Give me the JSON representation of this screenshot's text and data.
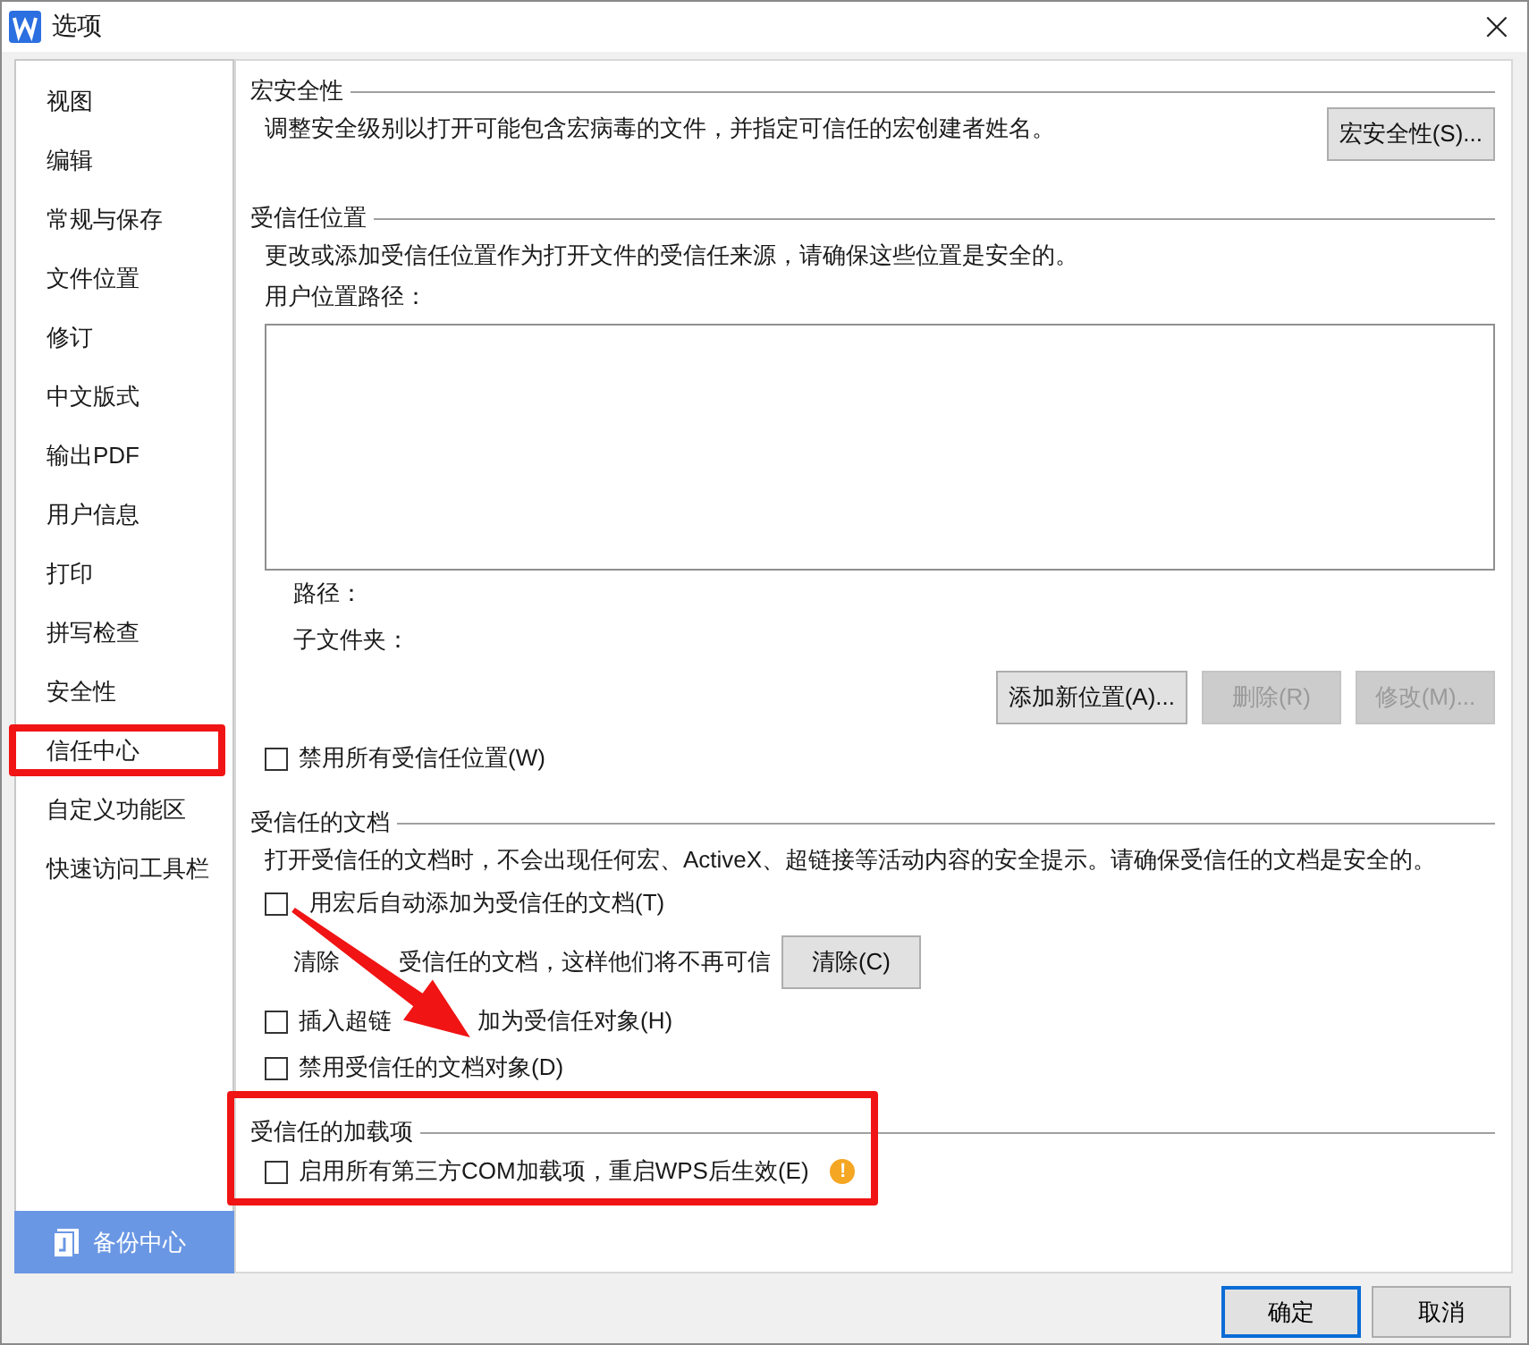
{
  "window": {
    "title": "选项",
    "close": "×"
  },
  "sidebar": {
    "items": [
      {
        "label": "视图",
        "highlighted": false
      },
      {
        "label": "编辑",
        "highlighted": false
      },
      {
        "label": "常规与保存",
        "highlighted": false
      },
      {
        "label": "文件位置",
        "highlighted": false
      },
      {
        "label": "修订",
        "highlighted": false
      },
      {
        "label": "中文版式",
        "highlighted": false
      },
      {
        "label": "输出PDF",
        "highlighted": false
      },
      {
        "label": "用户信息",
        "highlighted": false
      },
      {
        "label": "打印",
        "highlighted": false
      },
      {
        "label": "拼写检查",
        "highlighted": false
      },
      {
        "label": "安全性",
        "highlighted": false
      },
      {
        "label": "信任中心",
        "highlighted": true
      },
      {
        "label": "自定义功能区",
        "highlighted": false
      },
      {
        "label": "快速访问工具栏",
        "highlighted": false
      }
    ],
    "backup_button": "备份中心"
  },
  "sections": [
    {
      "heading": "宏安全性",
      "rows": [
        {
          "kind": "text_button",
          "text": "调整安全级别以打开可能包含宏病毒的文件，并指定可信任的宏创建者姓名。",
          "button": {
            "label": "宏安全性(S)...",
            "disabled": false
          }
        }
      ]
    },
    {
      "heading": "受信任位置",
      "rows": [
        {
          "kind": "text",
          "text": "更改或添加受信任位置作为打开文件的受信任来源，请确保这些位置是安全的。"
        },
        {
          "kind": "text",
          "text": "用户位置路径："
        },
        {
          "kind": "listbox"
        },
        {
          "kind": "info",
          "text": "路径："
        },
        {
          "kind": "info",
          "text": "子文件夹："
        },
        {
          "kind": "buttons",
          "buttons": [
            {
              "label": "添加新位置(A)...",
              "disabled": false
            },
            {
              "label": "删除(R)",
              "disabled": true
            },
            {
              "label": "修改(M)...",
              "disabled": true
            }
          ]
        },
        {
          "kind": "checkbox",
          "label": "禁用所有受信任位置(W)",
          "checked": false
        }
      ]
    },
    {
      "heading": "受信任的文档",
      "rows": [
        {
          "kind": "text",
          "text": "打开受信任的文档时，不会出现任何宏、ActiveX、超链接等活动内容的安全提示。请确保受信任的文档是安全的。"
        },
        {
          "kind": "checkbox_split",
          "segments": [
            "用宏后自动添加为受信任的文档(T)"
          ],
          "checked": false
        },
        {
          "kind": "info_button_split",
          "segments": [
            "清除",
            "受信任的文档，这样他们将不再可信"
          ],
          "button": {
            "label": "清除(C)",
            "disabled": false
          }
        },
        {
          "kind": "checkbox_split",
          "segments": [
            "插入超链",
            "加为受信任对象(H)"
          ],
          "checked": false
        },
        {
          "kind": "checkbox",
          "label": "禁用受信任的文档对象(D)",
          "checked": false
        }
      ]
    },
    {
      "heading": "受信任的加载项",
      "highlighted": true,
      "rows": [
        {
          "kind": "checkbox_warning",
          "label": "启用所有第三方COM加载项，重启WPS后生效(E)",
          "checked": false,
          "warning": "!"
        }
      ]
    }
  ],
  "footer": {
    "buttons": [
      {
        "label": "确定",
        "default": true
      },
      {
        "label": "取消",
        "default": false
      }
    ]
  }
}
